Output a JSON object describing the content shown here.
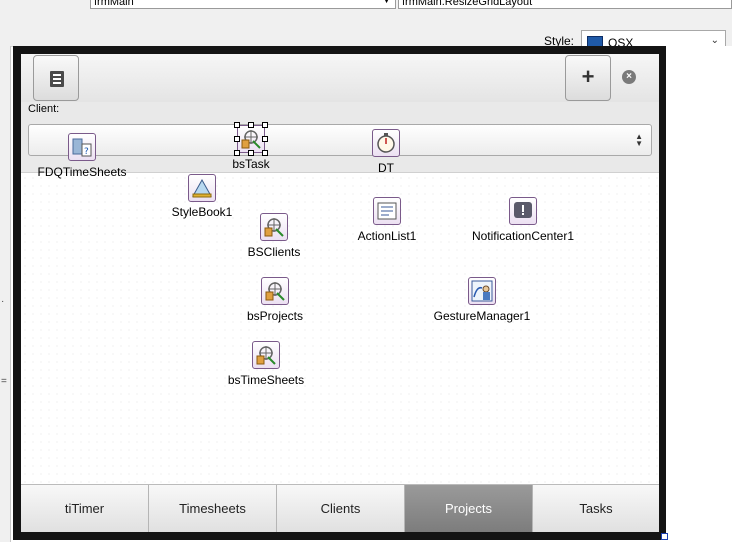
{
  "ide": {
    "form_combo": "frmMain",
    "event_combo": "frmMain.ResizeGridLayout",
    "style_label": "Style:",
    "style_value": "OSX"
  },
  "form": {
    "client_label": "Client:",
    "add_button": "+",
    "clear_glyph": "×",
    "tabs": [
      "tiTimer",
      "Timesheets",
      "Clients",
      "Projects",
      "Tasks"
    ],
    "active_tab": "Projects"
  },
  "components": {
    "fdq": "FDQTimeSheets",
    "bstask": "bsTask",
    "dt": "DT",
    "stylebook": "StyleBook1",
    "bsclients": "BSClients",
    "actionlist": "ActionList1",
    "notification": "NotificationCenter1",
    "bsprojects": "bsProjects",
    "gesture": "GestureManager1",
    "bstimesheets": "bsTimeSheets"
  },
  "colors": {
    "active_tab": "#8a8a8a",
    "selection": "#1a3fb0"
  }
}
